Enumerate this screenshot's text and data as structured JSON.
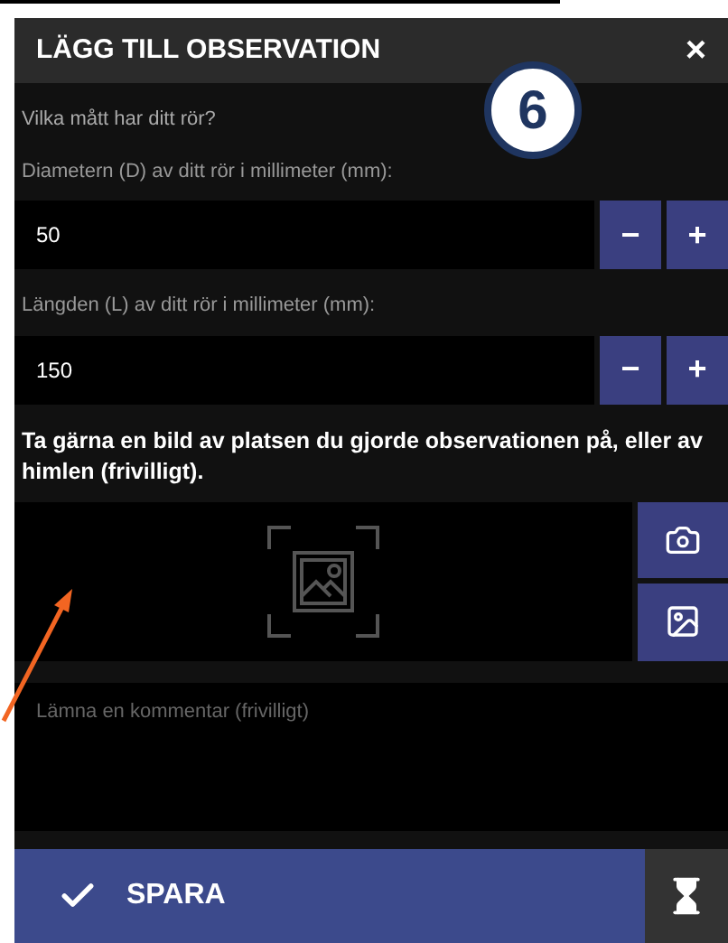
{
  "dialog": {
    "title": "LÄGG TILL OBSERVATION",
    "close": "×"
  },
  "badge": "6",
  "question": "Vilka mått har ditt rör?",
  "fields": [
    {
      "label": "Diametern (D) av ditt rör i millimeter (mm):",
      "value": "50",
      "minus": "−",
      "plus": "+"
    },
    {
      "label": "Längden (L) av ditt rör i millimeter (mm):",
      "value": "150",
      "minus": "−",
      "plus": "+"
    }
  ],
  "photo_prompt": "Ta gärna en bild av platsen du gjorde observationen på, eller av himlen (frivilligt).",
  "comment": {
    "placeholder": "Lämna en kommentar (frivilligt)"
  },
  "footer": {
    "save": "SPARA"
  }
}
